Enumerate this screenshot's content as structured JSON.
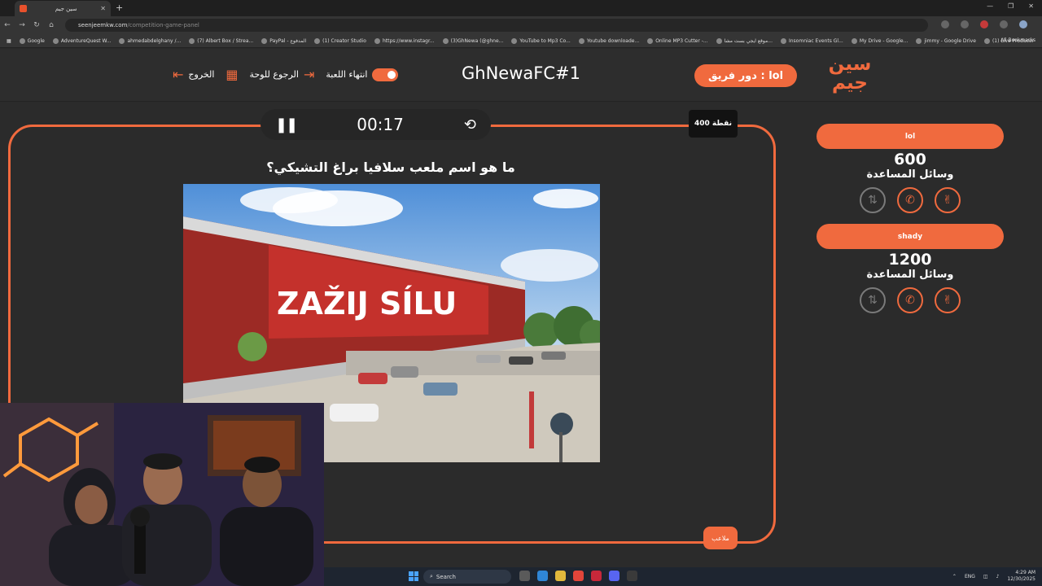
{
  "browser": {
    "tab_title": "سين جيم",
    "url_domain": "seenjeemkw.com",
    "url_path": "/competition-game-panel",
    "bookmarks": [
      "Google",
      "AdventureQuest W...",
      "ahmedabdelghany /...",
      "(7) Albert Box / Strea...",
      "PayPal - المدفوع",
      "(1) Creator Studio",
      "https://www.instagr...",
      "(3)GhNewa (@ghne...",
      "YouTube to Mp3 Co...",
      "Youtube downloade...",
      "Online MP3 Cutter -...",
      "موقع ايجي بست مشا...",
      "Insomniac Events Gl...",
      "My Drive - Google...",
      "jimmy - Google Drive",
      "(1) Live Producer"
    ],
    "all_bookmarks": "All Bookmarks"
  },
  "header": {
    "logo_line1": "سين",
    "logo_line2": "جيم",
    "turn_label": "دور فريق : lol",
    "game_title": "GhNewaFC#1",
    "end_game": "انتهاء اللعبة",
    "back_to_board": "الرجوع للوحة",
    "exit": "الخروج"
  },
  "game": {
    "timer": "00:17",
    "points": "400 نقطة",
    "question": "ما هو اسم ملعب سلافيا براغ التشيكي؟",
    "category": "ملاعب"
  },
  "teams": [
    {
      "name": "lol",
      "score": "600",
      "aids_label": "وسائل المساعدة"
    },
    {
      "name": "shady",
      "score": "1200",
      "aids_label": "وسائل المساعدة"
    }
  ],
  "stadium_sign": "ZAŽIJ SÍLU",
  "taskbar": {
    "search": "Search",
    "lang": "ENG",
    "time": "4:29 AM",
    "date": "12/30/2025"
  },
  "colors": {
    "accent": "#f06a3e",
    "background": "#2b2b2b"
  }
}
